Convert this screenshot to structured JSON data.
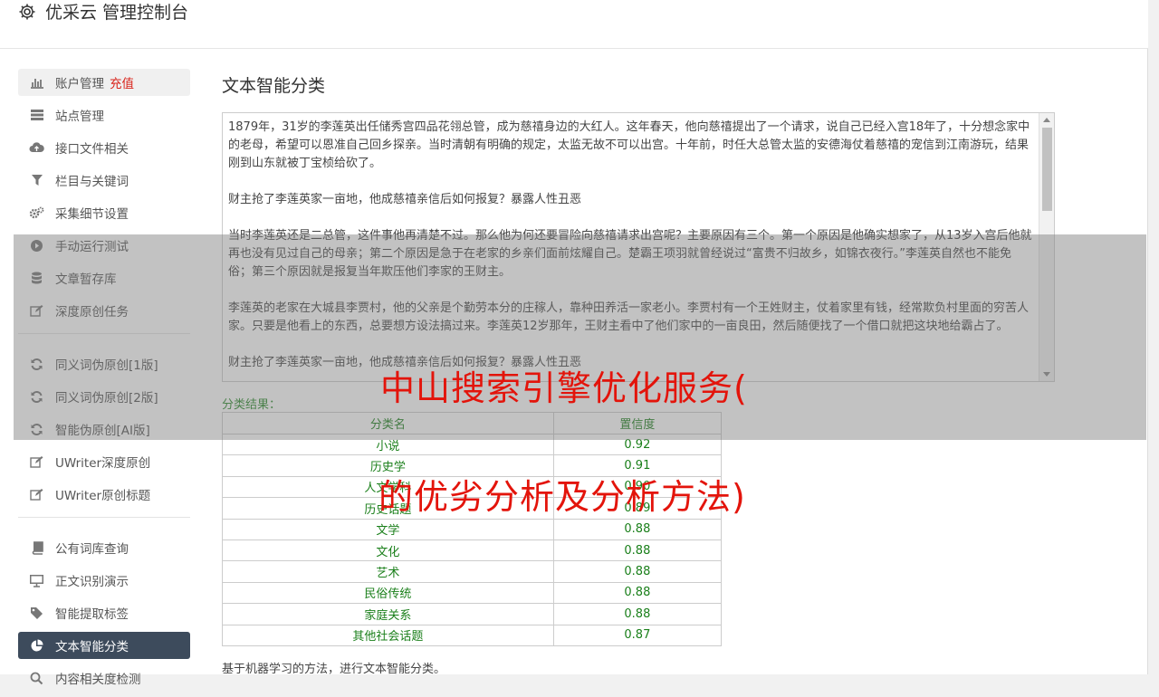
{
  "header": {
    "title": "优采云 管理控制台"
  },
  "sidebar": {
    "items": [
      {
        "label": "账户管理",
        "badge": "充值",
        "icon": "bar-chart-icon"
      },
      {
        "label": "站点管理",
        "icon": "list-icon"
      },
      {
        "label": "接口文件相关",
        "icon": "cloud-upload-icon"
      },
      {
        "label": "栏目与关键词",
        "icon": "filter-icon"
      },
      {
        "label": "采集细节设置",
        "icon": "gears-icon"
      },
      {
        "label": "手动运行测试",
        "icon": "play-icon"
      },
      {
        "label": "文章暂存库",
        "icon": "database-icon"
      },
      {
        "label": "深度原创任务",
        "icon": "edit-icon"
      },
      {
        "label": "同义词伪原创[1版]",
        "icon": "refresh-icon"
      },
      {
        "label": "同义词伪原创[2版]",
        "icon": "refresh-icon"
      },
      {
        "label": "智能伪原创[AI版]",
        "icon": "refresh-icon"
      },
      {
        "label": "UWriter深度原创",
        "icon": "edit-icon"
      },
      {
        "label": "UWriter原创标题",
        "icon": "edit-icon"
      },
      {
        "label": "公有词库查询",
        "icon": "book-icon"
      },
      {
        "label": "正文识别演示",
        "icon": "monitor-icon"
      },
      {
        "label": "智能提取标签",
        "icon": "tag-icon"
      },
      {
        "label": "文本智能分类",
        "icon": "pie-chart-icon"
      },
      {
        "label": "内容相关度检测",
        "icon": "search-icon"
      }
    ]
  },
  "main": {
    "title": "文本智能分类",
    "text_paragraphs": [
      "1879年，31岁的李莲英出任储秀宫四品花翎总管，成为慈禧身边的大红人。这年春天，他向慈禧提出了一个请求，说自己已经入宫18年了，十分想念家中的老母，希望可以恩准自己回乡探亲。当时清朝有明确的规定，太监无故不可以出宫。十年前，时任大总管太监的安德海仗着慈禧的宠信到江南游玩，结果刚到山东就被丁宝桢给砍了。",
      "财主抢了李莲英家一亩地，他成慈禧亲信后如何报复？暴露人性丑恶",
      "当时李莲英还是二总管，这件事他再清楚不过。那么他为何还要冒险向慈禧请求出宫呢？主要原因有三个。第一个原因是他确实想家了，从13岁入宫后他就再也没有见过自己的母亲；第二个原因是急于在老家的乡亲们面前炫耀自己。楚霸王项羽就曾经说过“富贵不归故乡，如锦衣夜行。”李莲英自然也不能免俗；第三个原因就是报复当年欺压他们李家的王财主。",
      "李莲英的老家在大城县李贾村，他的父亲是个勤劳本分的庄稼人，靠种田养活一家老小。李贾村有一个王姓财主，仗着家里有钱，经常欺负村里面的穷苦人家。只要是他看上的东西，总要想方设法搞过来。李莲英12岁那年，王财主看中了他们家中的一亩良田，然后随便找了一个借口就把这块地给霸占了。",
      "财主抢了李莲英家一亩地，他成慈禧亲信后如何报复？暴露人性丑恶"
    ],
    "result_label": "分类结果：",
    "table": {
      "headers": [
        "分类名",
        "置信度"
      ],
      "rows": [
        [
          "小说",
          "0.92"
        ],
        [
          "历史学",
          "0.91"
        ],
        [
          "人文学科",
          "0.90"
        ],
        [
          "历史话题",
          "0.89"
        ],
        [
          "文学",
          "0.88"
        ],
        [
          "文化",
          "0.88"
        ],
        [
          "艺术",
          "0.88"
        ],
        [
          "民俗传统",
          "0.88"
        ],
        [
          "家庭关系",
          "0.88"
        ],
        [
          "其他社会话题",
          "0.87"
        ]
      ]
    },
    "footnote": "基于机器学习的方法，进行文本智能分类。"
  },
  "watermark": {
    "line1": "中山搜索引擎优化服务(",
    "line2": "的优劣分析及分析方法)"
  },
  "colors": {
    "accent_red": "#d9231b",
    "active_nav": "#3d4b5c",
    "result_green": "#1a7f1a",
    "watermark_red": "#e3140b"
  }
}
